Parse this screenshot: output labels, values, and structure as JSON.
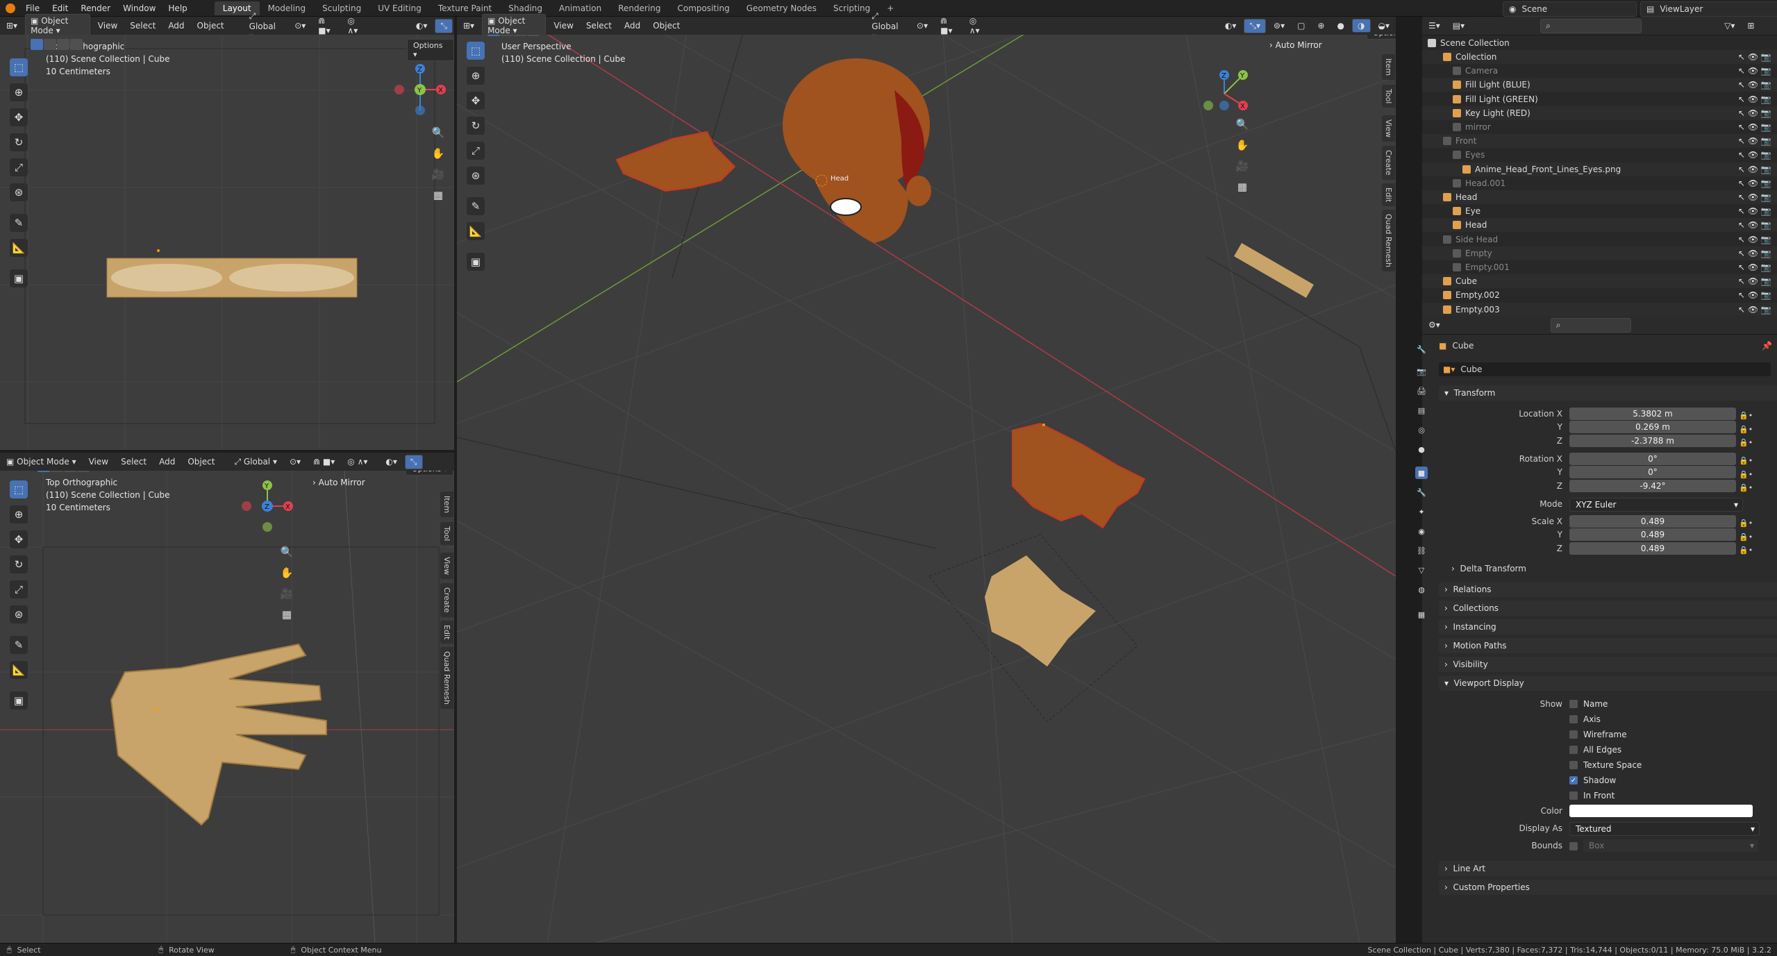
{
  "topbar": {
    "menus": [
      "File",
      "Edit",
      "Render",
      "Window",
      "Help"
    ],
    "workspaces": [
      "Layout",
      "Modeling",
      "Sculpting",
      "UV Editing",
      "Texture Paint",
      "Shading",
      "Animation",
      "Rendering",
      "Compositing",
      "Geometry Nodes",
      "Scripting"
    ],
    "active_workspace": "Layout",
    "add_tab": "+",
    "scene": "Scene",
    "view_layer": "ViewLayer"
  },
  "header": {
    "mode": "Object Mode",
    "menus": [
      "View",
      "Select",
      "Add",
      "Object"
    ],
    "orientation": "Global",
    "options": "Options"
  },
  "viewports": {
    "front": {
      "title": "Front Orthographic",
      "collection": "(110) Scene Collection | Cube",
      "scale": "10 Centimeters"
    },
    "top": {
      "title": "Top Orthographic",
      "collection": "(110) Scene Collection | Cube",
      "scale": "10 Centimeters",
      "panel": "Auto Mirror"
    },
    "main": {
      "title": "User Perspective",
      "collection": "(110) Scene Collection | Cube",
      "panel": "Auto Mirror",
      "head_label": "Head"
    }
  },
  "axes": {
    "x": "X",
    "y": "Y",
    "z": "Z"
  },
  "sidetabs": [
    "Item",
    "Tool",
    "View",
    "Create",
    "Edit",
    "Quad Remesh"
  ],
  "outliner": {
    "root": "Scene Collection",
    "rows": [
      {
        "name": "Collection",
        "level": 1,
        "dim": false
      },
      {
        "name": "Camera",
        "level": 2,
        "dim": true
      },
      {
        "name": "Fill Light (BLUE)",
        "level": 2,
        "dim": false
      },
      {
        "name": "Fill Light (GREEN)",
        "level": 2,
        "dim": false
      },
      {
        "name": "Key Light (RED)",
        "level": 2,
        "dim": false
      },
      {
        "name": "mirror",
        "level": 2,
        "dim": true
      },
      {
        "name": "Front",
        "level": 1,
        "dim": true
      },
      {
        "name": "Eyes",
        "level": 2,
        "dim": true
      },
      {
        "name": "Anime_Head_Front_Lines_Eyes.png",
        "level": 3,
        "dim": false
      },
      {
        "name": "Head.001",
        "level": 2,
        "dim": true
      },
      {
        "name": "Head",
        "level": 1,
        "dim": false
      },
      {
        "name": "Eye",
        "level": 2,
        "dim": false
      },
      {
        "name": "Head",
        "level": 2,
        "dim": false
      },
      {
        "name": "Side Head",
        "level": 1,
        "dim": true
      },
      {
        "name": "Empty",
        "level": 2,
        "dim": true
      },
      {
        "name": "Empty.001",
        "level": 2,
        "dim": true
      },
      {
        "name": "Cube",
        "level": 1,
        "dim": false
      },
      {
        "name": "Empty.002",
        "level": 1,
        "dim": false
      },
      {
        "name": "Empty.003",
        "level": 1,
        "dim": false
      }
    ]
  },
  "properties": {
    "object_name": "Cube",
    "datablock": "Cube",
    "transform": {
      "title": "Transform",
      "location_label": "Location X",
      "location": [
        "5.3802 m",
        "0.269 m",
        "-2.3788 m"
      ],
      "rotation_label": "Rotation X",
      "rotation": [
        "0°",
        "0°",
        "-9.42°"
      ],
      "mode_label": "Mode",
      "mode": "XYZ Euler",
      "scale_label": "Scale X",
      "scale": [
        "0.489",
        "0.489",
        "0.489"
      ],
      "y": "Y",
      "z": "Z",
      "delta": "Delta Transform"
    },
    "sections": [
      "Relations",
      "Collections",
      "Instancing",
      "Motion Paths",
      "Visibility"
    ],
    "viewport_display": {
      "title": "Viewport Display",
      "show_label": "Show",
      "options": [
        {
          "label": "Name",
          "checked": false
        },
        {
          "label": "Axis",
          "checked": false
        },
        {
          "label": "Wireframe",
          "checked": false
        },
        {
          "label": "All Edges",
          "checked": false
        },
        {
          "label": "Texture Space",
          "checked": false
        },
        {
          "label": "Shadow",
          "checked": true
        },
        {
          "label": "In Front",
          "checked": false
        }
      ],
      "color_label": "Color",
      "color_value": "#ffffff",
      "display_as_label": "Display As",
      "display_as": "Textured",
      "bounds_label": "Bounds",
      "bounds": "Box"
    },
    "extra_sections": [
      "Line Art",
      "Custom Properties"
    ]
  },
  "status": {
    "select": "Select",
    "rotate": "Rotate View",
    "context": "Object Context Menu",
    "stats": "Scene Collection | Cube | Verts:7,380 | Faces:7,372 | Tris:14,744 | Objects:0/11 | Memory: 75.0 MiB | 3.2.2"
  },
  "colors": {
    "accent": "#4772b3",
    "viewport": "#3d3d3d",
    "axis_x": "#e0414f",
    "axis_y": "#8bc34a",
    "axis_z": "#3b82d6",
    "skin": "#a0521f",
    "hand_tex": "#c9a46a"
  }
}
